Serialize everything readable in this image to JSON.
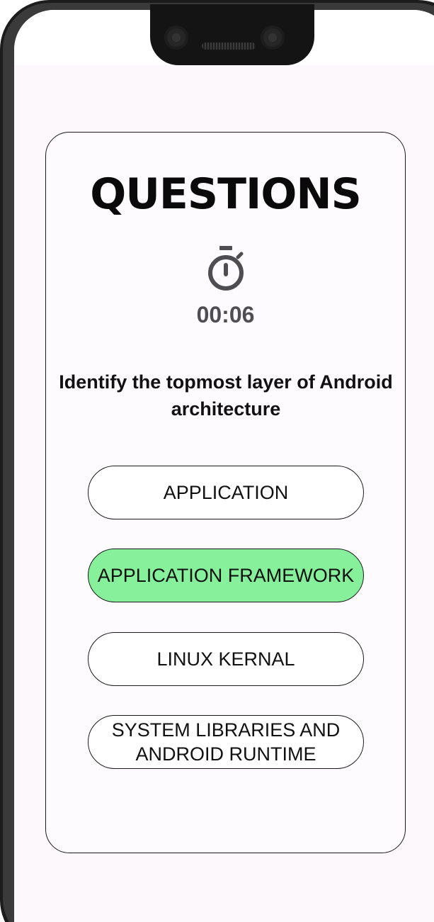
{
  "title": "QUESTIONS",
  "timer": {
    "icon": "stopwatch-icon",
    "value": "00:06"
  },
  "question": "Identify the topmost layer of Android architecture",
  "options": [
    {
      "label": "APPLICATION",
      "selected": false
    },
    {
      "label": "APPLICATION FRAMEWORK",
      "selected": true
    },
    {
      "label": "LINUX KERNAL",
      "selected": false
    },
    {
      "label": "SYSTEM LIBRARIES AND ANDROID RUNTIME",
      "selected": false
    }
  ],
  "colors": {
    "selected_option_bg": "#86f09a",
    "screen_bg": "#fdf8fc",
    "timer_text": "#4e4e52"
  }
}
